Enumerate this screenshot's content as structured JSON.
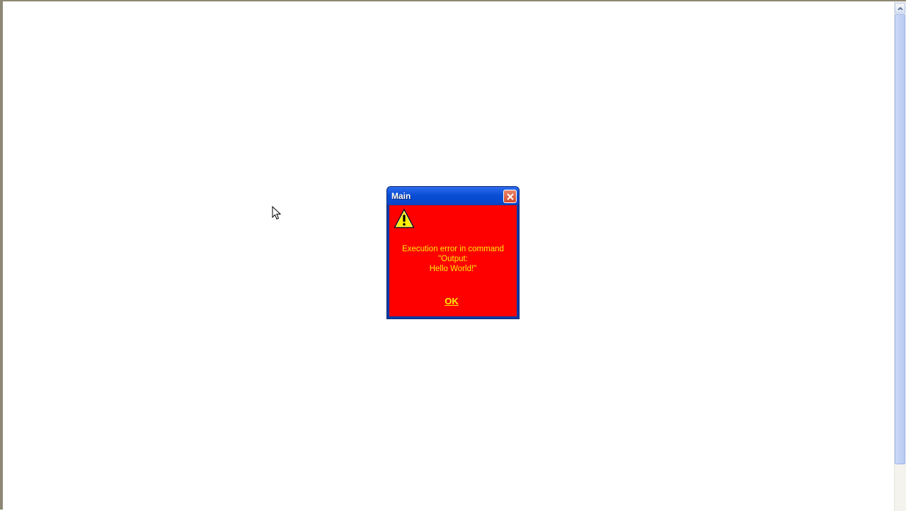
{
  "dialog": {
    "title": "Main",
    "message_lines": [
      "Execution error in command",
      "\"Output:",
      "Hello World!\""
    ],
    "ok_label": "OK"
  },
  "icons": {
    "warning": "warning-icon",
    "close": "close-icon",
    "scroll_up": "chevron-up-icon",
    "cursor": "mouse-pointer-icon"
  },
  "colors": {
    "dialog_body": "#ff0000",
    "dialog_text": "#ffee00",
    "titlebar": "#0a4fd6"
  }
}
